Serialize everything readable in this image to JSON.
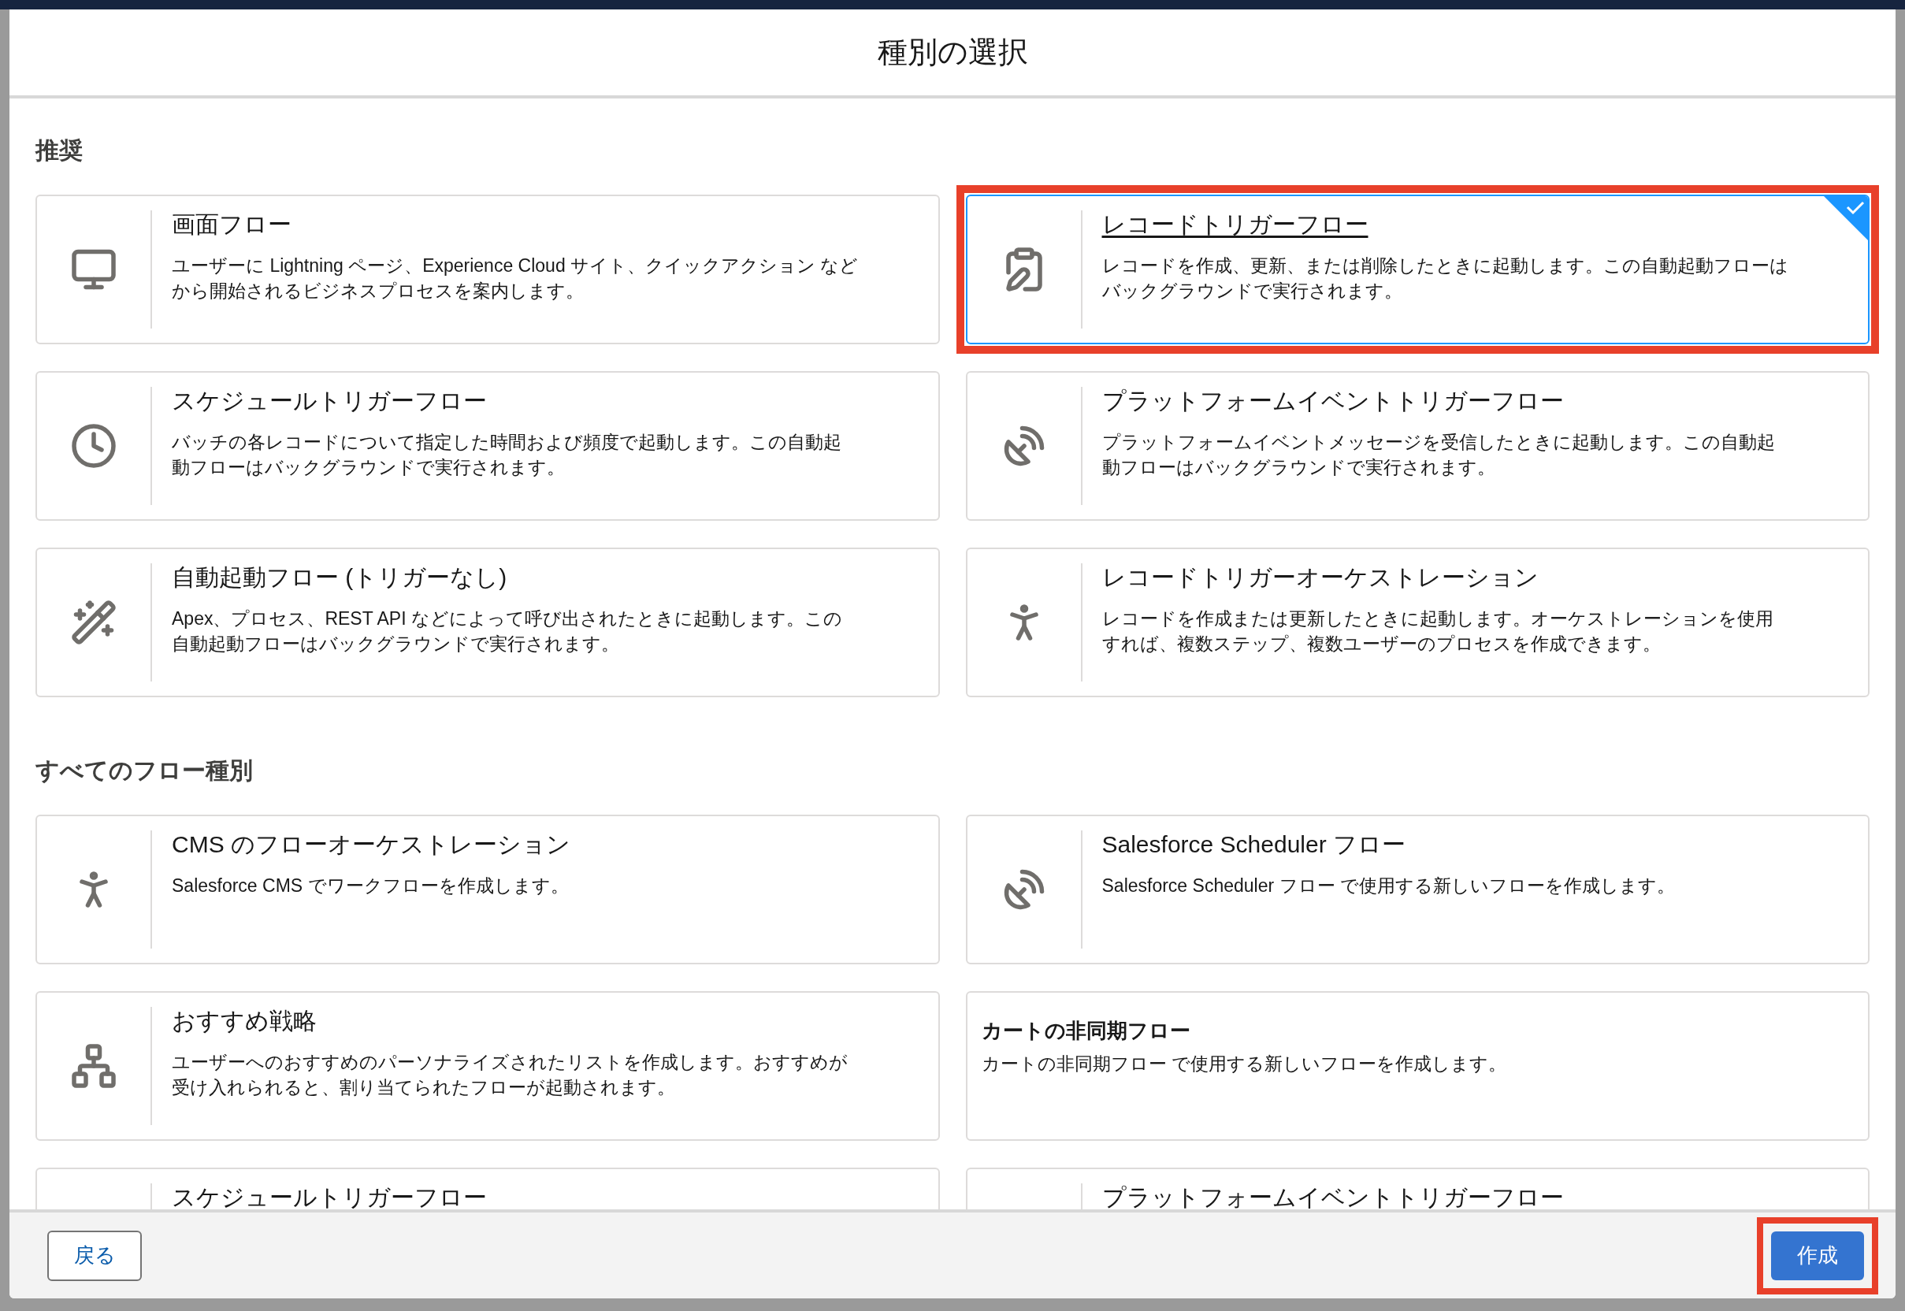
{
  "dialog": {
    "title": "種別の選択"
  },
  "sections": [
    {
      "heading": "推奨",
      "cards": [
        {
          "kind": "monitor",
          "title": "画面フロー",
          "description": "ユーザーに Lightning ページ、Experience Cloud サイト、クイックアクション などから開始されるビジネスプロセスを案内します。",
          "selected": false
        },
        {
          "kind": "clipboard",
          "title": "レコードトリガーフロー",
          "description": "レコードを作成、更新、または削除したときに起動します。この自動起動フローはバックグラウンドで実行されます。",
          "selected": true
        },
        {
          "kind": "clock",
          "title": "スケジュールトリガーフロー",
          "description": "バッチの各レコードについて指定した時間および頻度で起動します。この自動起動フローはバックグラウンドで実行されます。",
          "selected": false
        },
        {
          "kind": "dish",
          "title": "プラットフォームイベントトリガーフロー",
          "description": "プラットフォームイベントメッセージを受信したときに起動します。この自動起動フローはバックグラウンドで実行されます。",
          "selected": false
        },
        {
          "kind": "wand",
          "title": "自動起動フロー (トリガーなし)",
          "description": "Apex、プロセス、REST API などによって呼び出されたときに起動します。この自動起動フローはバックグラウンドで実行されます。",
          "selected": false
        },
        {
          "kind": "conductor",
          "title": "レコードトリガーオーケストレーション",
          "description": "レコードを作成または更新したときに起動します。オーケストレーションを使用すれば、複数ステップ、複数ユーザーのプロセスを作成できます。",
          "selected": false
        }
      ]
    },
    {
      "heading": "すべてのフロー種別",
      "cards": [
        {
          "kind": "conductor",
          "title": "CMS のフローオーケストレーション",
          "description": "Salesforce CMS でワークフローを作成します。",
          "selected": false
        },
        {
          "kind": "dish",
          "title": "Salesforce Scheduler フロー",
          "description": "Salesforce Scheduler フロー で使用する新しいフローを作成します。",
          "selected": false
        },
        {
          "kind": "hierarchy",
          "title": "おすすめ戦略",
          "description": "ユーザーへのおすすめのパーソナライズされたリストを作成します。おすすめが受け入れられると、割り当てられたフローが起動されます。",
          "selected": false
        },
        {
          "kind": "plain",
          "title": "カートの非同期フロー",
          "description": "カートの非同期フロー で使用する新しいフローを作成します。",
          "selected": false
        },
        {
          "kind": "clipped",
          "title": "スケジュールトリガーフロー",
          "selected": false
        },
        {
          "kind": "clipped",
          "title": "プラットフォームイベントトリガーフロー",
          "selected": false
        }
      ]
    }
  ],
  "footer": {
    "back": "戻る",
    "create": {
      "label": "作成",
      "highlighted": true
    }
  }
}
